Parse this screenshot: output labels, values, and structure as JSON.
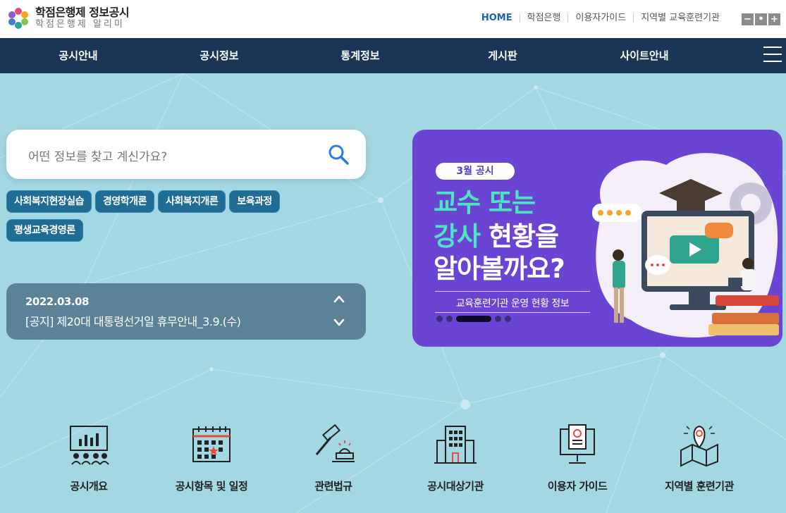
{
  "header": {
    "logo_title": "학점은행제 정보공시",
    "logo_subtitle": "학점은행제 알리미",
    "util_links": [
      "HOME",
      "학점은행",
      "이용자가이드",
      "지역별 교육훈련기관"
    ],
    "zoom_buttons": [
      "−",
      "•",
      "+"
    ]
  },
  "nav": {
    "items": [
      "공시안내",
      "공시정보",
      "통계정보",
      "게시판",
      "사이트안내"
    ],
    "menu_icon": "hamburger-icon"
  },
  "search": {
    "placeholder": "어떤 정보를 찾고 계신가요?",
    "icon": "search-icon",
    "keywords": [
      "사회복지현장실습",
      "경영학개론",
      "사회복지개론",
      "보육과정",
      "평생교육경영론"
    ]
  },
  "notice": {
    "date": "2022.03.08",
    "title": "[공지] 제20대 대통령선거일 휴무안내_3.9.(수)"
  },
  "banner": {
    "tag": "3월 공시",
    "line1": "교수 또는",
    "line2_highlight": "강사",
    "line2_rest": " 현황을",
    "line3": "알아볼까요?",
    "subtitle": "교육훈련기관 운영 현황 정보",
    "accent_color": "#4ee3c3",
    "background_color": "#6a45d3"
  },
  "quick_links": [
    {
      "label": "공시개요",
      "icon": "presentation-icon"
    },
    {
      "label": "공시항목 및 일정",
      "icon": "calendar-icon"
    },
    {
      "label": "관련법규",
      "icon": "gavel-icon"
    },
    {
      "label": "공시대상기관",
      "icon": "building-icon"
    },
    {
      "label": "이용자 가이드",
      "icon": "guide-icon"
    },
    {
      "label": "지역별 훈련기관",
      "icon": "map-pin-icon"
    }
  ]
}
